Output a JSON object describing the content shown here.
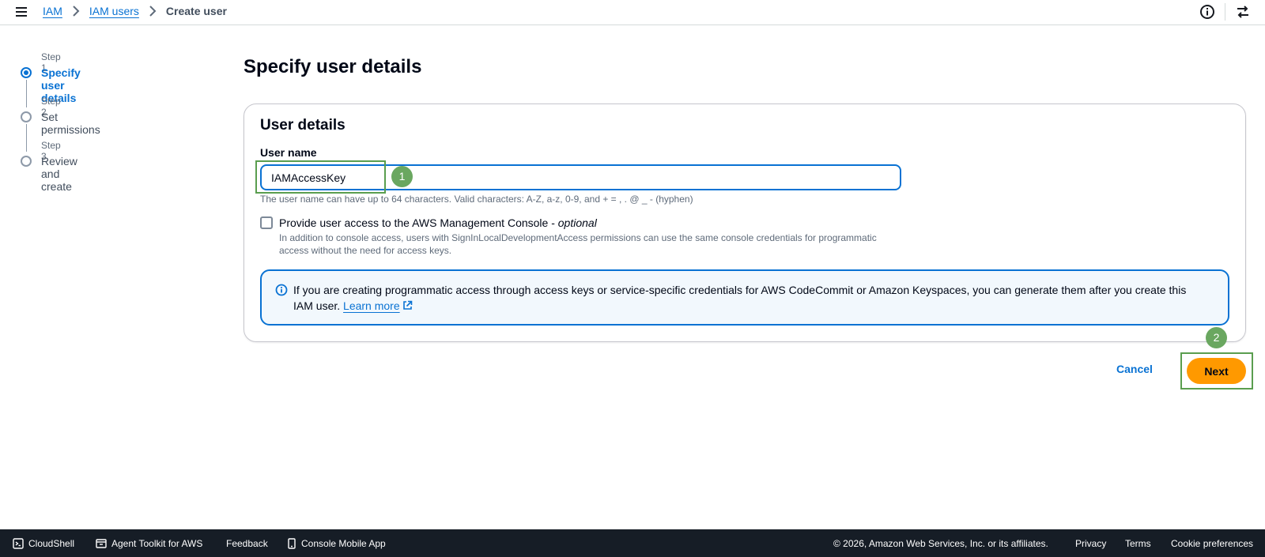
{
  "breadcrumb": {
    "root": "IAM",
    "parent": "IAM users",
    "current": "Create user"
  },
  "steps": [
    {
      "number": "Step 1",
      "title": "Specify user details",
      "active": true
    },
    {
      "number": "Step 2",
      "title": "Set permissions",
      "active": false
    },
    {
      "number": "Step 3",
      "title": "Review and create",
      "active": false
    }
  ],
  "main": {
    "title": "Specify user details",
    "panel_title": "User details",
    "username_label": "User name",
    "username_value": "IAMAccessKey",
    "username_hint": "The user name can have up to 64 characters. Valid characters: A-Z, a-z, 0-9, and + = , . @ _ - (hyphen)",
    "console_access_label": "Provide user access to the AWS Management Console - ",
    "console_access_optional": "optional",
    "console_access_desc": "In addition to console access, users with SignInLocalDevelopmentAccess permissions can use the same console credentials for programmatic access without the need for access keys.",
    "console_access_checked": false,
    "info_text": "If you are creating programmatic access through access keys or service-specific credentials for AWS CodeCommit or Amazon Keyspaces, you can generate them after you create this IAM user.",
    "learn_more": "Learn more"
  },
  "actions": {
    "cancel": "Cancel",
    "next": "Next"
  },
  "annotations": {
    "marker1": "1",
    "marker2": "2"
  },
  "footer": {
    "cloudshell": "CloudShell",
    "agent_toolkit": "Agent Toolkit for AWS",
    "feedback": "Feedback",
    "mobile_app": "Console Mobile App",
    "copyright": "© 2026, Amazon Web Services, Inc. or its affiliates.",
    "privacy": "Privacy",
    "terms": "Terms",
    "cookies": "Cookie preferences"
  },
  "colors": {
    "accent": "#0972d3",
    "primary_button": "#ff9900",
    "footer_bg": "#161d26",
    "annotation": "#6aa760"
  }
}
